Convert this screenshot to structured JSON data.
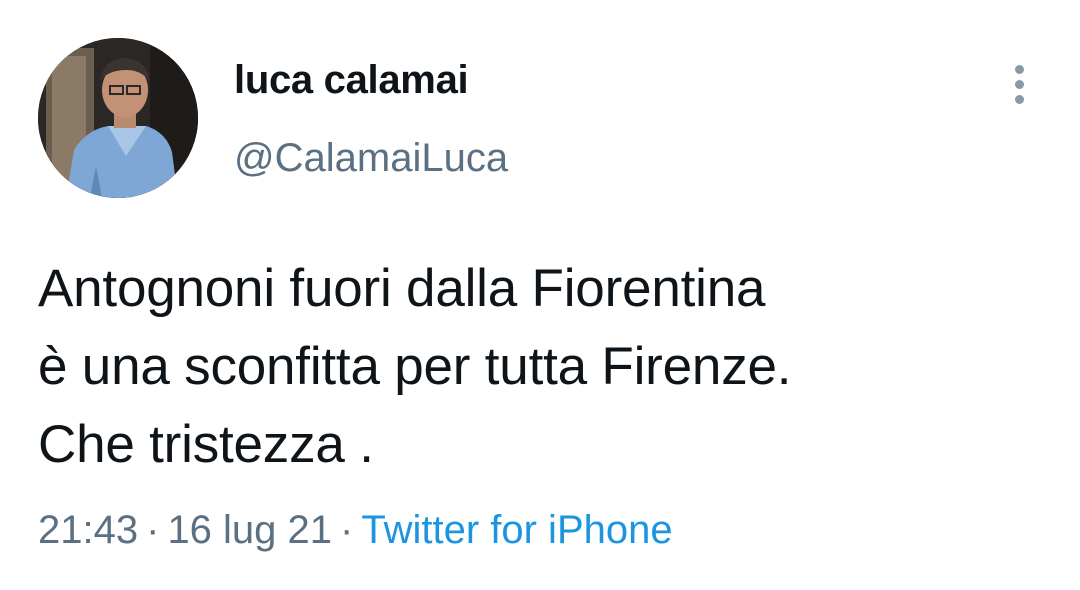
{
  "user": {
    "display_name": "luca calamai",
    "handle": "@CalamaiLuca"
  },
  "tweet": {
    "lines": [
      "Antognoni fuori dalla Fiorentina",
      "è una sconfitta per tutta Firenze.",
      "Che tristezza ."
    ]
  },
  "meta": {
    "time": "21:43",
    "separator": "·",
    "date": "16 lug 21",
    "source": "Twitter for iPhone"
  },
  "icons": {
    "more": "more-vertical-icon"
  },
  "colors": {
    "text": "#0f1419",
    "secondary": "#5b7083",
    "link": "#1b95e0"
  }
}
